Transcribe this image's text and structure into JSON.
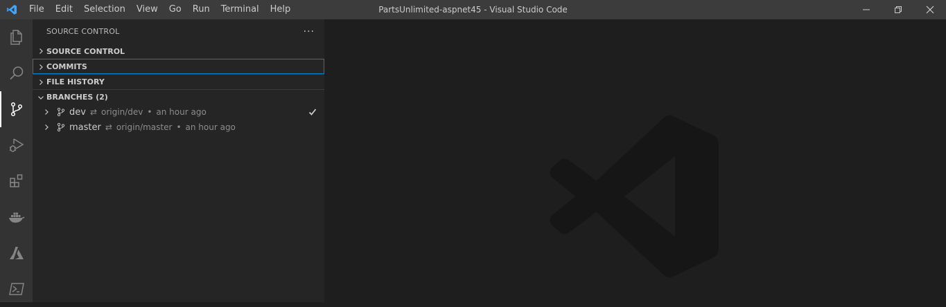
{
  "titlebar": {
    "logo_icon": "vscode-logo-icon",
    "window_title": "PartsUnlimited-aspnet45 - Visual Studio Code",
    "menu": [
      "File",
      "Edit",
      "Selection",
      "View",
      "Go",
      "Run",
      "Terminal",
      "Help"
    ],
    "controls": [
      "minimize-icon",
      "restore-icon",
      "close-icon"
    ]
  },
  "activitybar": {
    "items": [
      {
        "name": "explorer",
        "icon": "files-icon"
      },
      {
        "name": "search",
        "icon": "search-icon"
      },
      {
        "name": "source-control",
        "icon": "source-control-icon",
        "active": true
      },
      {
        "name": "run-debug",
        "icon": "run-debug-icon"
      },
      {
        "name": "extensions",
        "icon": "extensions-icon"
      },
      {
        "name": "docker",
        "icon": "docker-icon"
      },
      {
        "name": "azure",
        "icon": "azure-icon"
      },
      {
        "name": "powershell",
        "icon": "powershell-icon"
      }
    ]
  },
  "sidebar": {
    "title": "SOURCE CONTROL",
    "more_label": "···",
    "sections": [
      {
        "label": "SOURCE CONTROL",
        "expanded": false
      },
      {
        "label": "COMMITS",
        "expanded": false,
        "focused": true
      },
      {
        "label": "FILE HISTORY",
        "expanded": false
      },
      {
        "label": "BRANCHES (2)",
        "expanded": true
      }
    ],
    "branches": [
      {
        "name": "dev",
        "sync_icon": "⇄",
        "upstream": "origin/dev",
        "separator": "•",
        "time": "an hour ago",
        "current": true
      },
      {
        "name": "master",
        "sync_icon": "⇄",
        "upstream": "origin/master",
        "separator": "•",
        "time": "an hour ago",
        "current": false
      }
    ]
  },
  "colors": {
    "titlebar": "#3c3c3c",
    "activitybar": "#333333",
    "sidebar": "#252526",
    "editor": "#1e1e1e",
    "focus": "#007fd4"
  }
}
